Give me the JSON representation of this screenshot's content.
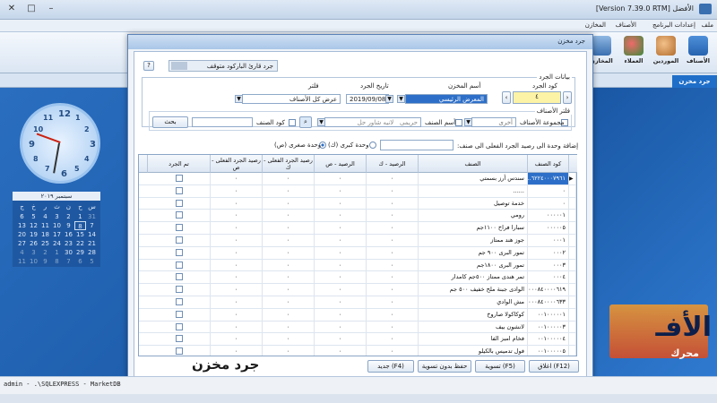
{
  "window": {
    "title": "الأفضل [Version 7.39.0 RTM]"
  },
  "menubar": {
    "items": [
      "ملف",
      "إعدادات البرنامج",
      "الأصناف",
      "المخازن"
    ]
  },
  "ribbon": {
    "buttons": [
      "الأصناف",
      "الموردين",
      "العملاء",
      "المخازن"
    ]
  },
  "tabs": {
    "active": "جرد مخزن"
  },
  "dialog": {
    "title": "جرد مخزن",
    "help_button": "?",
    "barcode_reader_label": "جرد قارئ الباركود متوقف",
    "section_header": "بيانات الجرد",
    "inv_code_label": "كود الجرد",
    "inv_code_value": "٤",
    "store_name_label": "أسم المخزن",
    "store_name_value": "المعرض الرئيسي",
    "inv_date_label": "تاريخ الجرد",
    "inv_date_value": "2019/09/08",
    "filter_label": "فلتر",
    "filter_value": "عرض كل الأصناف",
    "items_filter_label": "فلتر الأصناف",
    "item_group_label": "مجموعة الأصناف",
    "item_group_value": "أخرى",
    "item_name_label": "أسم الصنف",
    "item_name_placeholder": "حريمى",
    "item_name_value2": "لانيه شاور جل",
    "item_code_label": "كود الصنف",
    "search_button": "بحث",
    "add_unit_label": "إضافة وحدة الى رصيد الجرد الفعلى الى صنف:",
    "unit_big": "وحدة كبرى (ك)",
    "unit_small": "وحدة صغرى (ص)",
    "columns": {
      "item_code": "كود الصنف",
      "item": "الصنف",
      "balance_big": "الرصيد - ك",
      "balance_small": "الرصيد - ص",
      "actual_big": "رصيد الجرد الفعلى - ك",
      "actual_small": "رصيد الجرد الفعلى - ص",
      "done": "تم الجرد"
    },
    "rows": [
      {
        "code": "٦٢٢٤٠٠٠٧٩٦١...",
        "name": "سندس أرز بسمتي",
        "b": "٠",
        "s": "٠",
        "ab": "٠",
        "as": "٠"
      },
      {
        "code": "٠",
        "name": "......",
        "b": "٠",
        "s": "٠",
        "ab": "٠",
        "as": "٠"
      },
      {
        "code": "٠",
        "name": "خدمة توصيل",
        "b": "٠",
        "s": "٠",
        "ab": "٠",
        "as": "٠"
      },
      {
        "code": "٠٠٠٠٠١",
        "name": "رومي",
        "b": "٠",
        "s": "٠",
        "ab": "٠",
        "as": "٠"
      },
      {
        "code": "٠٠٠٠٠٥",
        "name": "سبارا فراخ ١١٠٠جم",
        "b": "٠",
        "s": "٠",
        "ab": "٠",
        "as": "٠"
      },
      {
        "code": "٠٠٠١",
        "name": "جوز هند ممتاز",
        "b": "٠",
        "s": "٠",
        "ab": "٠",
        "as": "٠"
      },
      {
        "code": "٠٠٠٢",
        "name": "تمور البرى ٩٠٠ جم",
        "b": "٠",
        "s": "٠",
        "ab": "٠",
        "as": "٠"
      },
      {
        "code": "٠٠٠٣",
        "name": "تمور البرى ١٨٠٠جم",
        "b": "٠",
        "s": "٠",
        "ab": "٠",
        "as": "٠"
      },
      {
        "code": "٠٠٠٤",
        "name": "تمر هندى ممتاز ٥٠٠جم كامدار",
        "b": "٠",
        "s": "٠",
        "ab": "٠",
        "as": "٠"
      },
      {
        "code": "٠٠٠٨٤٠٠٠٠٦١٩",
        "name": "الوادى جبنة ملح خفيف ٥٠٠ جم",
        "b": "٠",
        "s": "٠",
        "ab": "٠",
        "as": "٠"
      },
      {
        "code": "٠٠٠٨٤٠٠٠٠٦٣٣",
        "name": "مش الوادي",
        "b": "٠",
        "s": "٠",
        "ab": "٠",
        "as": "٠"
      },
      {
        "code": "٠٠١٠٠٠٠٠١",
        "name": "كوكاكولا صاروخ",
        "b": "٠",
        "s": "٠",
        "ab": "٠",
        "as": "٠"
      },
      {
        "code": "٠٠١٠٠٠٠٠٣",
        "name": "لانشون بيف",
        "b": "٠",
        "s": "٠",
        "ab": "٠",
        "as": "٠"
      },
      {
        "code": "٠٠١٠٠٠٠٠٤",
        "name": "فخام امبز الفا",
        "b": "٠",
        "s": "٠",
        "ab": "٠",
        "as": "٠"
      },
      {
        "code": "٠٠١٠٠٠٠٠٥",
        "name": "فول تدميس بالكيلو",
        "b": "٠",
        "s": "٠",
        "ab": "٠",
        "as": "٠"
      }
    ],
    "buttons": {
      "close": "اغلاق (F12)",
      "settle": "تسوية (F5)",
      "save_no_settle": "حفظ بدون تسوية",
      "new": "جديد (F4)"
    },
    "caption": "جرد مخزن"
  },
  "calendar": {
    "header": "سبتمبر ٢٠١٩",
    "weekdays": [
      "س",
      "ح",
      "ن",
      "ث",
      "ر",
      "خ",
      "ج"
    ],
    "days": [
      [
        "31",
        "1",
        "2",
        "3",
        "4",
        "5",
        "6"
      ],
      [
        "7",
        "8",
        "9",
        "10",
        "11",
        "12",
        "13"
      ],
      [
        "14",
        "15",
        "16",
        "17",
        "18",
        "19",
        "20"
      ],
      [
        "21",
        "22",
        "23",
        "24",
        "25",
        "26",
        "27"
      ],
      [
        "28",
        "29",
        "30",
        "1",
        "2",
        "3",
        "4"
      ],
      [
        "5",
        "6",
        "7",
        "8",
        "9",
        "10",
        "11"
      ]
    ]
  },
  "status": {
    "text": "admin  -  .\\SQLEXPRESS  -  MarketDB"
  },
  "brand": {
    "text": "الأفـ",
    "sub": "محرك"
  },
  "colors": {
    "accent": "#1f6fc9",
    "selection": "#2d6fc8"
  }
}
